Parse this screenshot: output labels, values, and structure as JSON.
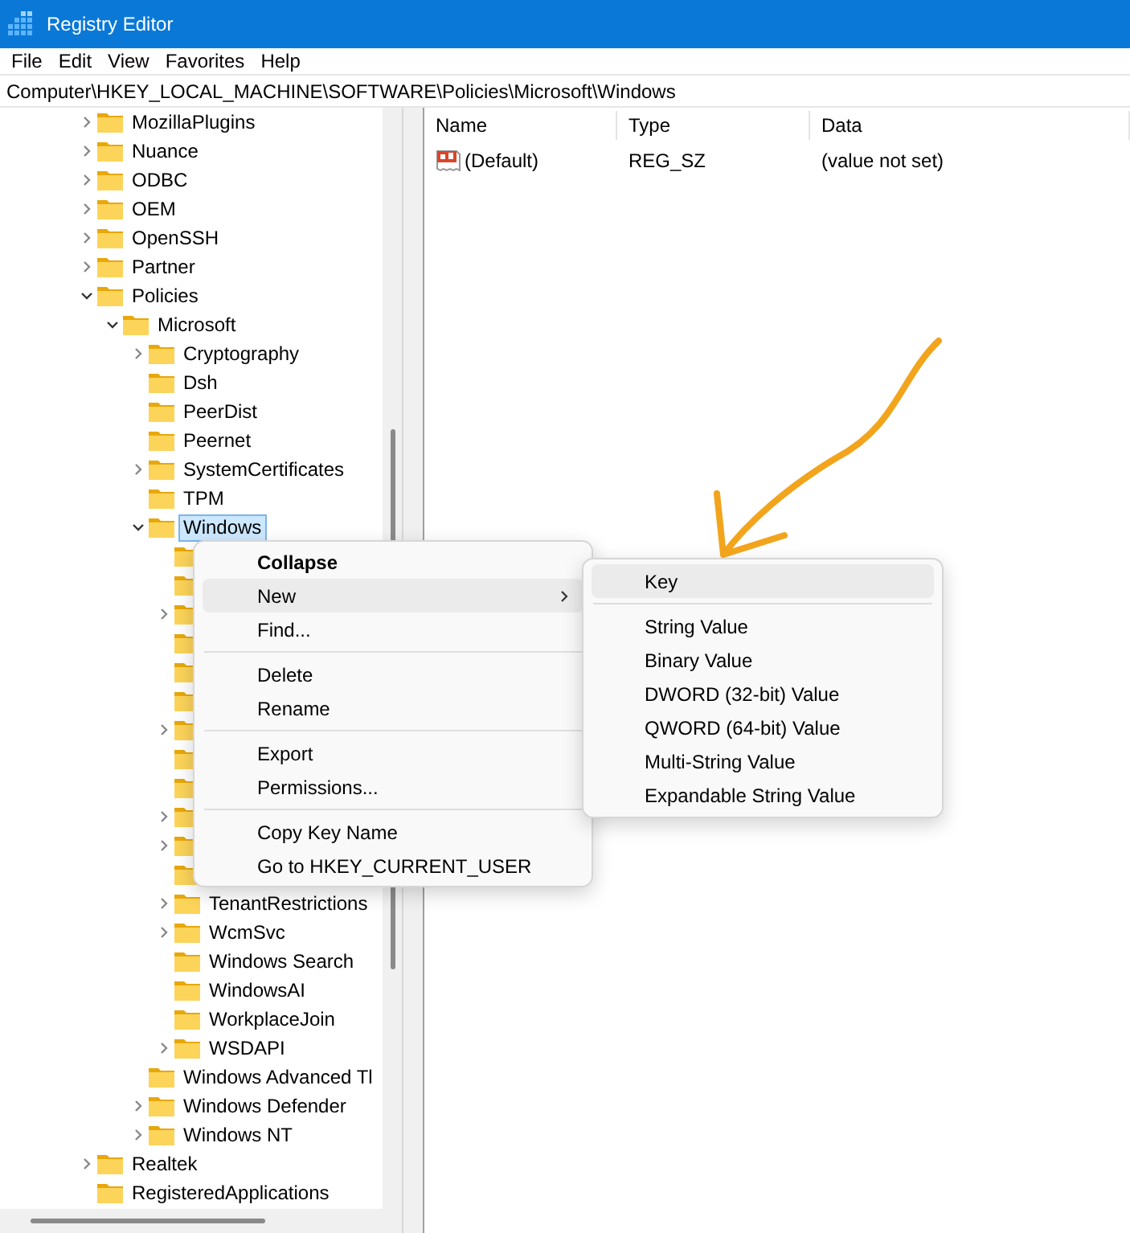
{
  "window": {
    "title": "Registry Editor"
  },
  "menu_bar": [
    "File",
    "Edit",
    "View",
    "Favorites",
    "Help"
  ],
  "address_bar": {
    "value": "Computer\\HKEY_LOCAL_MACHINE\\SOFTWARE\\Policies\\Microsoft\\Windows"
  },
  "tree": [
    {
      "label": "MozillaPlugins",
      "expandable": true,
      "expanded": false,
      "selected": false
    },
    {
      "label": "Nuance",
      "expandable": true,
      "expanded": false,
      "selected": false
    },
    {
      "label": "ODBC",
      "expandable": true,
      "expanded": false,
      "selected": false
    },
    {
      "label": "OEM",
      "expandable": true,
      "expanded": false,
      "selected": false
    },
    {
      "label": "OpenSSH",
      "expandable": true,
      "expanded": false,
      "selected": false
    },
    {
      "label": "Partner",
      "expandable": true,
      "expanded": false,
      "selected": false
    },
    {
      "label": "Policies",
      "expandable": true,
      "expanded": true,
      "selected": false,
      "children": [
        {
          "label": "Microsoft",
          "expandable": true,
          "expanded": true,
          "selected": false,
          "children": [
            {
              "label": "Cryptography",
              "expandable": true,
              "expanded": false,
              "selected": false
            },
            {
              "label": "Dsh",
              "expandable": false,
              "selected": false
            },
            {
              "label": "PeerDist",
              "expandable": false,
              "selected": false
            },
            {
              "label": "Peernet",
              "expandable": false,
              "selected": false
            },
            {
              "label": "SystemCertificates",
              "expandable": true,
              "expanded": false,
              "selected": false
            },
            {
              "label": "TPM",
              "expandable": false,
              "selected": false
            },
            {
              "label": "Windows",
              "expandable": true,
              "expanded": true,
              "selected": true,
              "children": [
                {
                  "expandable": false
                },
                {
                  "expandable": false
                },
                {
                  "expandable": true,
                  "expanded": false
                },
                {
                  "expandable": false
                },
                {
                  "expandable": false
                },
                {
                  "expandable": false
                },
                {
                  "expandable": true,
                  "expanded": false
                },
                {
                  "expandable": false
                },
                {
                  "expandable": false
                },
                {
                  "expandable": true,
                  "expanded": false
                },
                {
                  "expandable": true,
                  "expanded": false
                },
                {
                  "expandable": false
                },
                {
                  "label": "TenantRestrictions",
                  "expandable": true,
                  "expanded": false,
                  "selected": false
                },
                {
                  "label": "WcmSvc",
                  "expandable": true,
                  "expanded": false,
                  "selected": false
                },
                {
                  "label": "Windows Search",
                  "expandable": false,
                  "selected": false
                },
                {
                  "label": "WindowsAI",
                  "expandable": false,
                  "selected": false
                },
                {
                  "label": "WorkplaceJoin",
                  "expandable": false,
                  "selected": false
                },
                {
                  "label": "WSDAPI",
                  "expandable": true,
                  "expanded": false,
                  "selected": false
                }
              ]
            },
            {
              "label": "Windows Advanced Tl",
              "expandable": false,
              "selected": false
            },
            {
              "label": "Windows Defender",
              "expandable": true,
              "expanded": false,
              "selected": false
            },
            {
              "label": "Windows NT",
              "expandable": true,
              "expanded": false,
              "selected": false
            }
          ]
        }
      ]
    },
    {
      "label": "Realtek",
      "expandable": true,
      "expanded": false,
      "selected": false
    },
    {
      "label": "RegisteredApplications",
      "expandable": false,
      "selected": false
    }
  ],
  "values_list": {
    "columns": [
      "Name",
      "Type",
      "Data"
    ],
    "rows": [
      {
        "name": "(Default)",
        "type": "REG_SZ",
        "data": "(value not set)"
      }
    ]
  },
  "context_menu": {
    "groups": [
      [
        {
          "label": "Collapse",
          "bold": true,
          "selected": false,
          "submenu": false
        },
        {
          "label": "New",
          "bold": false,
          "selected": true,
          "submenu": true
        },
        {
          "label": "Find...",
          "bold": false,
          "selected": false,
          "submenu": false
        }
      ],
      [
        {
          "label": "Delete",
          "bold": false,
          "selected": false,
          "submenu": false
        },
        {
          "label": "Rename",
          "bold": false,
          "selected": false,
          "submenu": false
        }
      ],
      [
        {
          "label": "Export",
          "bold": false,
          "selected": false,
          "submenu": false
        },
        {
          "label": "Permissions...",
          "bold": false,
          "selected": false,
          "submenu": false
        }
      ],
      [
        {
          "label": "Copy Key Name",
          "bold": false,
          "selected": false,
          "submenu": false
        },
        {
          "label": "Go to HKEY_CURRENT_USER",
          "bold": false,
          "selected": false,
          "submenu": false
        }
      ]
    ]
  },
  "submenu": {
    "groups": [
      [
        {
          "label": "Key",
          "selected": true
        }
      ],
      [
        {
          "label": "String Value",
          "selected": false
        },
        {
          "label": "Binary Value",
          "selected": false
        },
        {
          "label": "DWORD (32-bit) Value",
          "selected": false
        },
        {
          "label": "QWORD (64-bit) Value",
          "selected": false
        },
        {
          "label": "Multi-String Value",
          "selected": false
        },
        {
          "label": "Expandable String Value",
          "selected": false
        }
      ]
    ]
  }
}
